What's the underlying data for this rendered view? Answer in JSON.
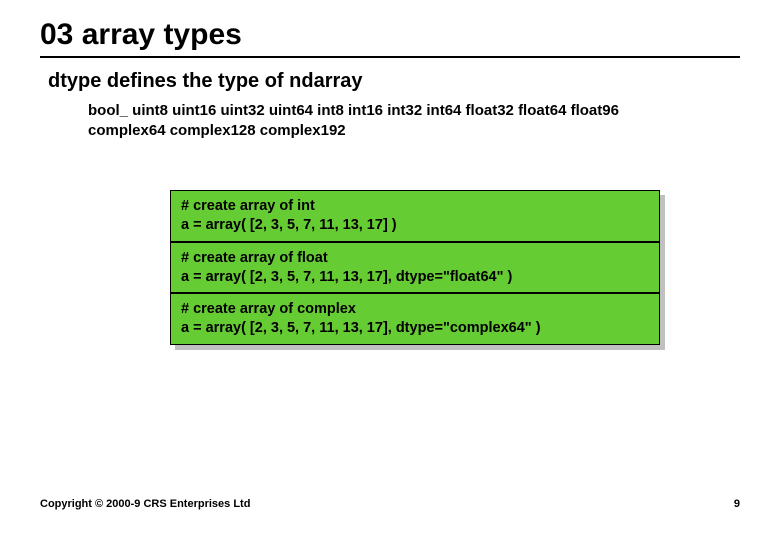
{
  "title": "03 array types",
  "subtitle": "dtype defines the type of ndarray",
  "dtype_list": "bool_ uint8 uint16 uint32 uint64 int8 int16 int32 int64 float32 float64 float96 complex64 complex128 complex192",
  "code_boxes": [
    {
      "comment": "# create array of int",
      "code_prefix": "a = array( [2, 3, 5, 7, 11, 13, 17] )",
      "code_bold": ""
    },
    {
      "comment": "# create array of float",
      "code_prefix": "a = array( [2, 3, 5, 7, 11, 13, 17], ",
      "code_bold": "dtype=\"float64\"",
      "code_suffix": " )"
    },
    {
      "comment": "# create array of complex",
      "code_prefix": "a = array( [2, 3, 5, 7, 11, 13, 17], ",
      "code_bold": "dtype=\"complex64\"",
      "code_suffix": " )"
    }
  ],
  "footer": {
    "copyright": "Copyright © 2000-9 CRS Enterprises Ltd",
    "page_number": "9"
  }
}
